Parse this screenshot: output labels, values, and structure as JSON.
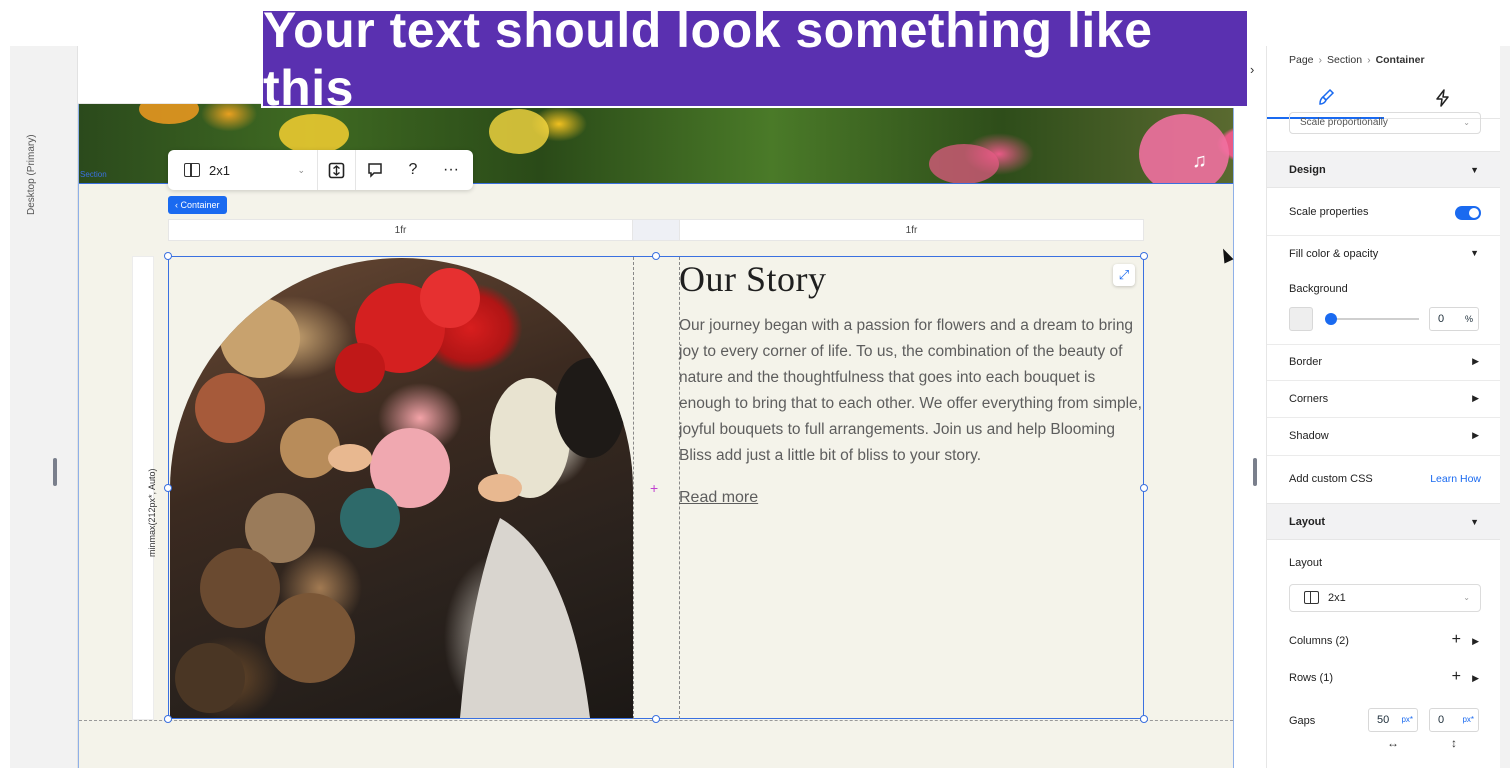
{
  "overlay": {
    "banner_text": "Your text should look something like this"
  },
  "left_rail": {
    "device_label": "Desktop (Primary)"
  },
  "canvas": {
    "section_tag": "Section",
    "container_chip": "Container",
    "toolbar": {
      "layout_value": "2x1",
      "help_label": "?",
      "more_label": "···"
    },
    "columns": [
      "1fr",
      "1fr"
    ],
    "row_label": "minmax(212px*, Auto)",
    "story": {
      "title": "Our Story",
      "body": "Our journey began with a passion for flowers and a dream to bring joy to every corner of life. To us, the combination of the beauty of nature and the thoughtfulness that goes into each bouquet is enough to bring that to each other. We offer everything from simple, joyful bouquets to full arrangements. Join us and help Blooming Bliss add just a little bit of bliss to your story.",
      "link": "Read more"
    }
  },
  "panel": {
    "breadcrumb": {
      "page": "Page",
      "section": "Section",
      "current": "Container"
    },
    "scale_dropdown": "Scale proportionally",
    "design": {
      "heading": "Design",
      "scale_properties": "Scale properties",
      "fill_label": "Fill color & opacity",
      "background_label": "Background",
      "opacity_value": "0",
      "opacity_unit": "%",
      "border": "Border",
      "corners": "Corners",
      "shadow": "Shadow",
      "custom_css": "Add custom CSS",
      "learn_how": "Learn How"
    },
    "layout": {
      "heading": "Layout",
      "layout_label": "Layout",
      "layout_value": "2x1",
      "columns": "Columns (2)",
      "rows": "Rows (1)",
      "gaps": "Gaps",
      "gap_h": "50",
      "gap_v": "0",
      "gap_unit": "px*"
    }
  },
  "colors": {
    "accent": "#1a6af0",
    "banner": "#5a30b0",
    "canvas_bg": "#f4f3ea"
  }
}
